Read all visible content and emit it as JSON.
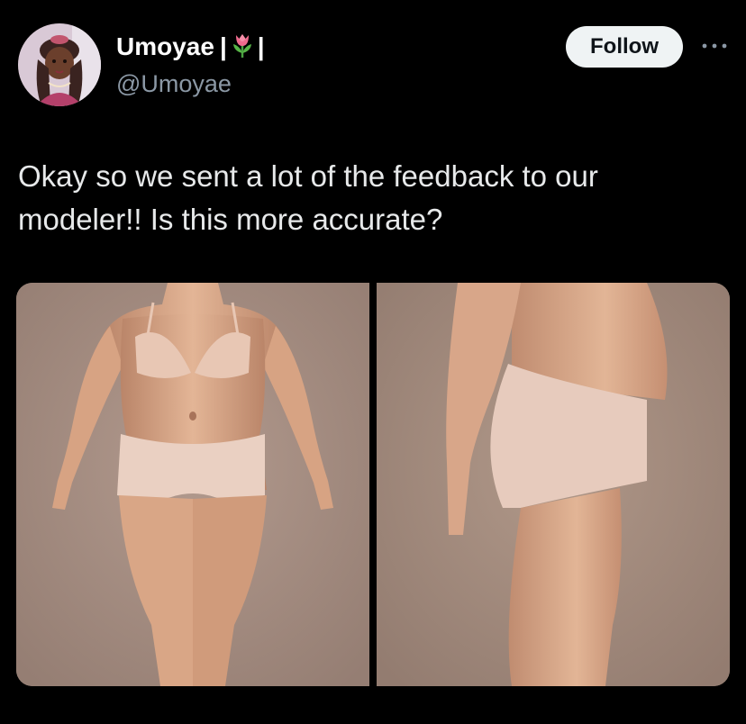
{
  "user": {
    "display_name": "Umoyae",
    "name_separator_left": "|",
    "name_separator_right": "|",
    "name_emoji": "tulip-icon",
    "handle": "@Umoyae"
  },
  "actions": {
    "follow_label": "Follow",
    "more_icon": "ellipsis-icon"
  },
  "tweet": {
    "text": "Okay so we sent a lot of the feedback to our modeler!! Is this more accurate?"
  },
  "media": {
    "images": [
      {
        "name": "front-view-image"
      },
      {
        "name": "side-view-image"
      }
    ]
  },
  "colors": {
    "background": "#000000",
    "text": "#e7e9ea",
    "secondary_text": "#8b98a5",
    "follow_button": "#eff3f4",
    "image_background": "#a08a7f"
  }
}
